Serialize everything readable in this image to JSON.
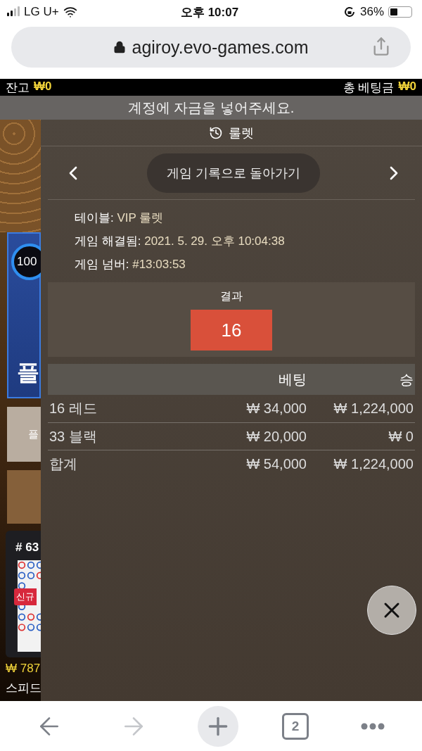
{
  "status_bar": {
    "carrier": "LG U+",
    "time": "오후 10:07",
    "battery": "36%"
  },
  "address_bar": {
    "url": "agiroy.evo-games.com"
  },
  "balance_bar": {
    "balance_label": "잔고",
    "balance": "₩0",
    "total_bet_label": "총 베팅금",
    "total_bet": "₩0"
  },
  "notice": "계정에 자금을 넣어주세요.",
  "lobby_strip": {
    "card_badge": "100",
    "card_title": "플",
    "tile_text": "플",
    "game_number": "# 63",
    "new_badge": "신규",
    "jackpot": "₩ 787",
    "game_name": "스피드"
  },
  "history_panel": {
    "title": "룰렛",
    "back_button": "게임 기록으로 돌아가기",
    "details": [
      {
        "label": "테이블:",
        "value": "VIP 룰렛"
      },
      {
        "label": "게임 해결됨:",
        "value": "2021. 5. 29. 오후 10:04:38"
      },
      {
        "label": "게임 넘버:",
        "value": "#13:03:53"
      }
    ],
    "result_label": "결과",
    "result": {
      "number": "16",
      "color": "#d9503a"
    },
    "bets_table": {
      "columns": [
        "베팅",
        "승"
      ],
      "rows": [
        {
          "bet": "16 레드",
          "stake": "₩ 34,000",
          "win": "₩ 1,224,000"
        },
        {
          "bet": "33 블랙",
          "stake": "₩ 20,000",
          "win": "₩ 0"
        }
      ],
      "total": {
        "bet": "합계",
        "stake": "₩ 54,000",
        "win": "₩ 1,224,000"
      }
    }
  },
  "toolbar": {
    "tab_count": "2",
    "forward_disabled": true
  }
}
